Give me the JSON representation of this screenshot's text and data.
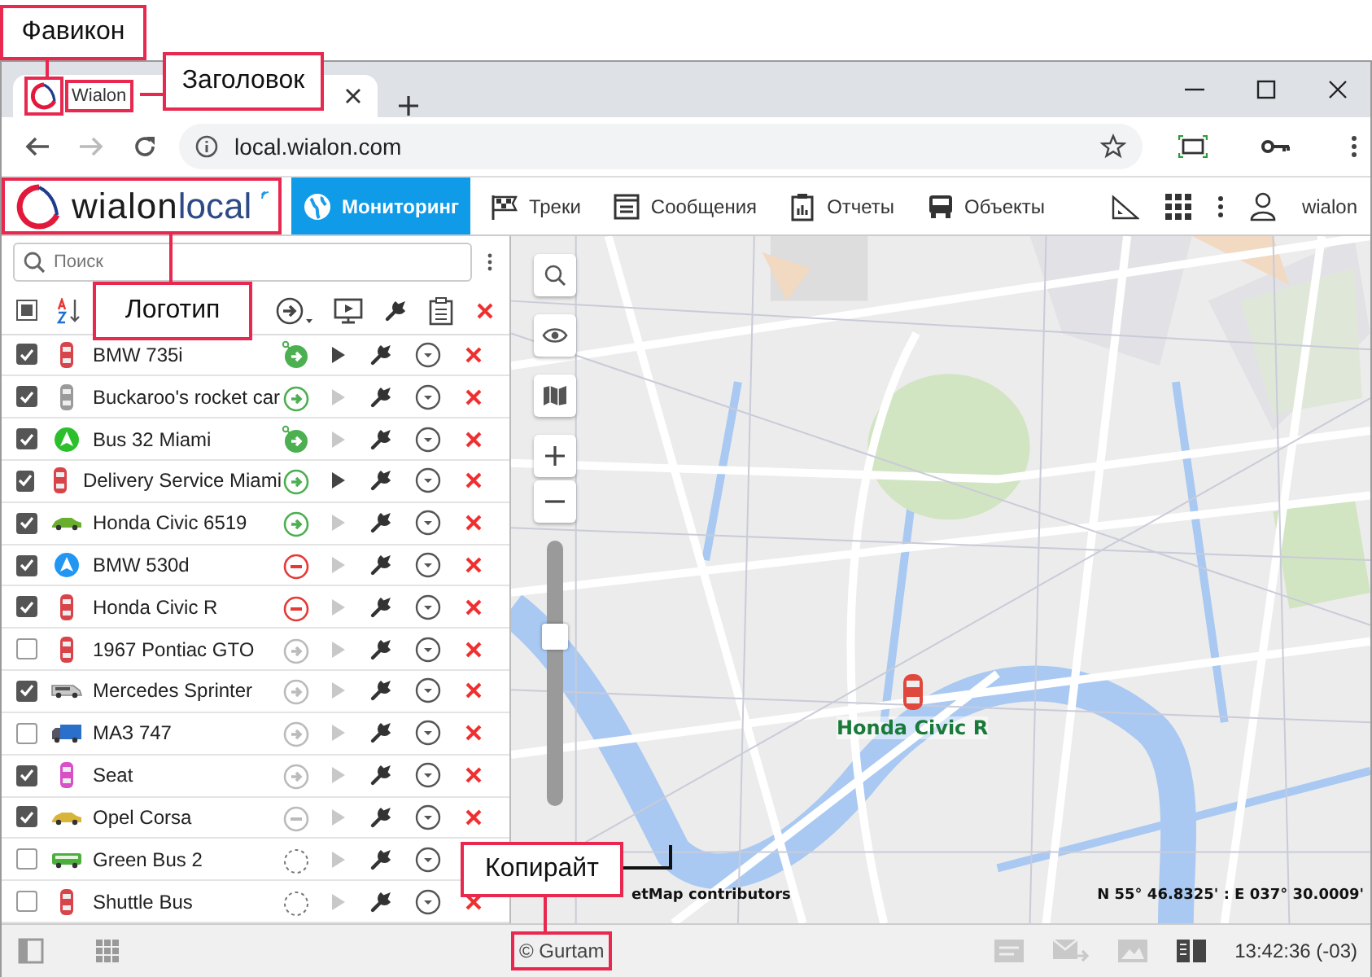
{
  "browser": {
    "tab": {
      "title": "Wialon"
    },
    "url": "local.wialon.com"
  },
  "app": {
    "logo": {
      "name": "wialon",
      "suffix": "local"
    },
    "nav": [
      {
        "label": "Мониторинг",
        "kind": "globe",
        "selected": true
      },
      {
        "label": "Треки",
        "kind": "flag",
        "selected": false
      },
      {
        "label": "Сообщения",
        "kind": "messages",
        "selected": false
      },
      {
        "label": "Отчеты",
        "kind": "report",
        "selected": false
      },
      {
        "label": "Объекты",
        "kind": "bus",
        "selected": false
      }
    ],
    "user": "wialon"
  },
  "search": {
    "placeholder": "Поиск"
  },
  "units": [
    {
      "name": "BMW 735i",
      "checked": true,
      "kind": "car",
      "color": "#d9434a",
      "has_data": true,
      "online": true,
      "moving": true,
      "marked": true,
      "track_shown": true
    },
    {
      "name": "Buckaroo's rocket car",
      "checked": true,
      "kind": "car",
      "color": "#9a9a9a",
      "has_data": true,
      "online": true,
      "moving": true,
      "marked": false,
      "track_shown": false
    },
    {
      "name": "Bus 32 Miami",
      "checked": true,
      "kind": "arrow",
      "color": "#2bc02b",
      "has_data": true,
      "online": true,
      "moving": true,
      "marked": true,
      "track_shown": false
    },
    {
      "name": "Delivery Service Miami",
      "checked": true,
      "kind": "car",
      "color": "#d9434a",
      "has_data": true,
      "online": true,
      "moving": true,
      "marked": false,
      "track_shown": true
    },
    {
      "name": "Honda Civic 6519",
      "checked": true,
      "kind": "sedan",
      "color": "#6aae2f",
      "has_data": true,
      "online": true,
      "moving": true,
      "marked": false,
      "track_shown": false
    },
    {
      "name": "BMW 530d",
      "checked": true,
      "kind": "arrow",
      "color": "#2196f3",
      "has_data": true,
      "online": true,
      "moving": false,
      "marked": false,
      "track_shown": false
    },
    {
      "name": "Honda Civic R",
      "checked": true,
      "kind": "car",
      "color": "#d9434a",
      "has_data": true,
      "online": true,
      "moving": false,
      "marked": false,
      "track_shown": false
    },
    {
      "name": "1967 Pontiac GTO",
      "checked": false,
      "kind": "car",
      "color": "#d9434a",
      "has_data": true,
      "online": false,
      "moving": true,
      "marked": false,
      "track_shown": false
    },
    {
      "name": "Mercedes Sprinter",
      "checked": true,
      "kind": "van",
      "color": "#c8c8c8",
      "has_data": true,
      "online": false,
      "moving": true,
      "marked": false,
      "track_shown": false
    },
    {
      "name": "МАЗ 747",
      "checked": false,
      "kind": "truck",
      "color": "#2a6fc9",
      "has_data": true,
      "online": false,
      "moving": true,
      "marked": false,
      "track_shown": false
    },
    {
      "name": "Seat",
      "checked": true,
      "kind": "car",
      "color": "#d94fc8",
      "has_data": true,
      "online": false,
      "moving": true,
      "marked": false,
      "track_shown": false
    },
    {
      "name": "Opel Corsa",
      "checked": true,
      "kind": "sedan",
      "color": "#d9b43a",
      "has_data": true,
      "online": false,
      "moving": false,
      "marked": false,
      "track_shown": false
    },
    {
      "name": "Green Bus 2",
      "checked": false,
      "kind": "bus",
      "color": "#4cae3c",
      "has_data": false,
      "marked": false,
      "track_shown": false
    },
    {
      "name": "Shuttle Bus",
      "checked": false,
      "kind": "car",
      "color": "#d9434a",
      "has_data": false,
      "marked": false,
      "track_shown": false
    }
  ],
  "map": {
    "unit_label": "Honda Civic R",
    "attribution": "etMap contributors",
    "coordinates": "N 55° 46.8325' : E 037° 30.0009'",
    "zoom": {
      "level": 0.64
    }
  },
  "status_bar": {
    "copyright": "© Gurtam",
    "time": "13:42:36 (-03)"
  },
  "annotations": [
    {
      "label": "Фавикон",
      "kind": "favicon"
    },
    {
      "label": "Заголовок",
      "kind": "title"
    },
    {
      "label": "Логотип",
      "kind": "logo"
    },
    {
      "label": "Копирайт",
      "kind": "copyright"
    }
  ]
}
